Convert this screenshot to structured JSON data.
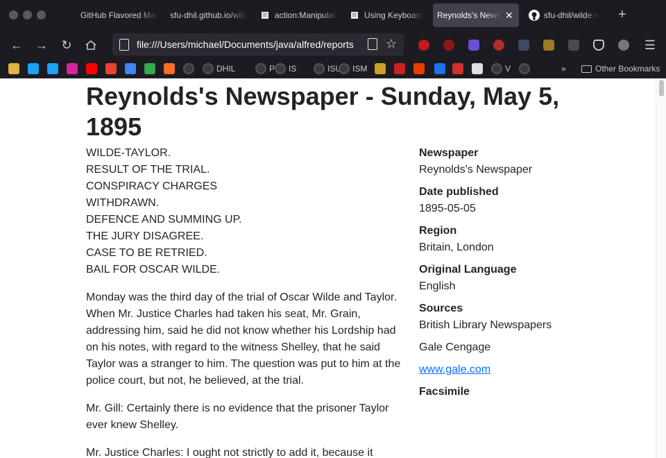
{
  "browser": {
    "tabs": [
      {
        "label": "GitHub Flavored Markdown",
        "icon": "markdown-icon",
        "active": false
      },
      {
        "label": "sfu-dhil.github.io/wilde",
        "icon": "none",
        "active": false
      },
      {
        "label": "action:Manipulate",
        "icon": "doc-icon",
        "active": false
      },
      {
        "label": "Using Keyboard",
        "icon": "doc-icon",
        "active": false
      },
      {
        "label": "Reynolds's Newspaper",
        "icon": "none",
        "active": true
      },
      {
        "label": "sfu-dhil/wilde-s",
        "icon": "github-icon",
        "active": false
      }
    ],
    "url": "file:///Users/michael/Documents/java/alfred/reports",
    "bookmarks": [
      {
        "label": "",
        "color": "#e3b341"
      },
      {
        "label": "",
        "color": "#1da1f2"
      },
      {
        "label": "",
        "color": "#1da1f2"
      },
      {
        "label": "",
        "color": "#d6249f"
      },
      {
        "label": "",
        "color": "#ff0000"
      },
      {
        "label": "",
        "color": "#ea4335"
      },
      {
        "label": "",
        "color": "#4285f4"
      },
      {
        "label": "",
        "color": "#34a853"
      },
      {
        "label": "",
        "color": "#fc6d26"
      },
      {
        "label": "",
        "color": "#55545c"
      },
      {
        "label": "DHIL",
        "color": "#55545c"
      },
      {
        "label": "PR",
        "color": "#55545c"
      },
      {
        "label": "IS",
        "color": "#55545c"
      },
      {
        "label": "ISU",
        "color": "#55545c"
      },
      {
        "label": "ISM",
        "color": "#55545c"
      },
      {
        "label": "",
        "color": "#c9a227"
      },
      {
        "label": "",
        "color": "#cc2222"
      },
      {
        "label": "",
        "color": "#eb3c00"
      },
      {
        "label": "",
        "color": "#1a73e8"
      },
      {
        "label": "",
        "color": "#d32f2f"
      },
      {
        "label": "",
        "color": "#e0e0e0"
      },
      {
        "label": "V",
        "color": "#c8c7cc"
      },
      {
        "label": "",
        "color": "#c8c7cc"
      }
    ],
    "other_bookmarks": "Other Bookmarks"
  },
  "page": {
    "title": "Reynolds's Newspaper - Sunday, May 5, 1895",
    "headlines": [
      "WILDE-TAYLOR.",
      "RESULT OF THE TRIAL.",
      "CONSPIRACY CHARGES",
      "WITHDRAWN.",
      "DEFENCE AND SUMMING UP.",
      "THE JURY DISAGREE.",
      "CASE TO BE RETRIED.",
      "BAIL FOR OSCAR WILDE."
    ],
    "paragraphs": [
      "Monday was the third day of the trial of Oscar Wilde and Taylor. When Mr. Justice Charles had taken his seat, Mr. Grain, addressing him, said he did not know whether his Lordship had on his notes, with regard to the witness Shelley, that he said Taylor was a stranger to him. The question was put to him at the police court, but not, he believed, at the trial.",
      "Mr. Gill: Certainly there is no evidence that the prisoner Taylor ever knew Shelley.",
      "Mr. Justice Charles: I ought not strictly to add it, because it"
    ],
    "sidebar": {
      "newspaper_label": "Newspaper",
      "newspaper": "Reynolds's Newspaper",
      "date_label": "Date published",
      "date": "1895-05-05",
      "region_label": "Region",
      "region": "Britain, London",
      "language_label": "Original Language",
      "language": "English",
      "sources_label": "Sources",
      "source1": "British Library Newspapers",
      "source2": "Gale Cengage",
      "source_link": "www.gale.com",
      "facsimile_label": "Facsimile"
    }
  }
}
